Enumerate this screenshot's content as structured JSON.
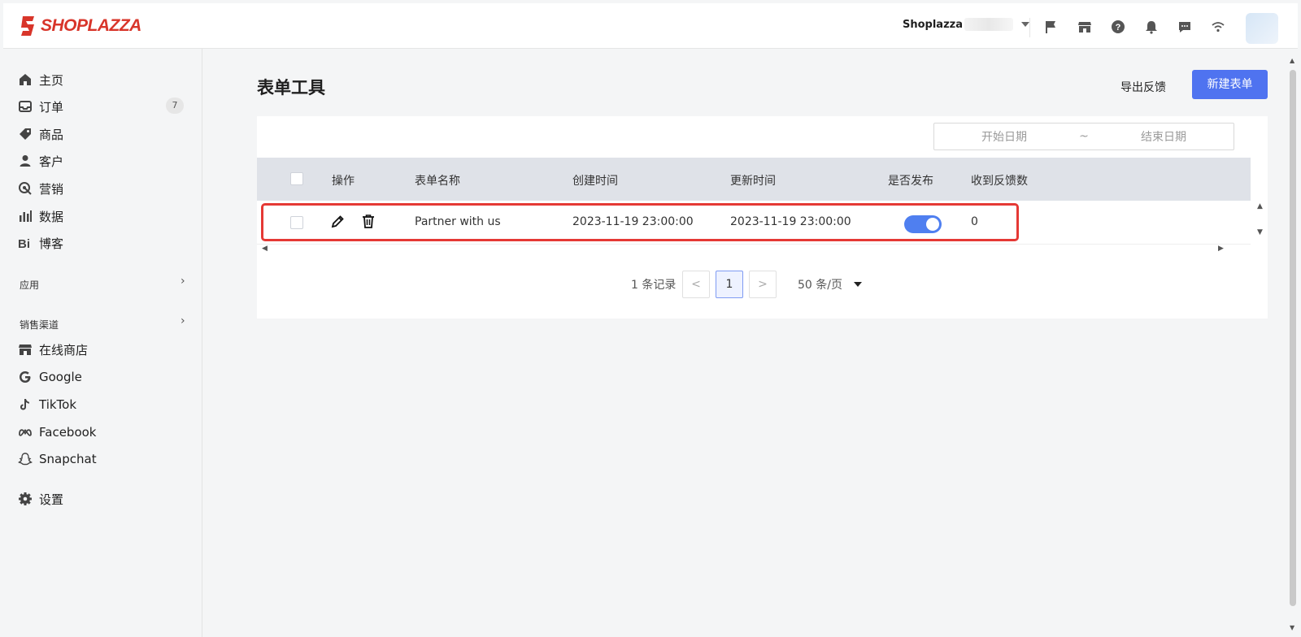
{
  "brand": {
    "name": "SHOPLAZZA",
    "color": "#d8352a"
  },
  "topbar": {
    "store_name": "Shoplazza",
    "icons": [
      "flag-icon",
      "store-icon",
      "help-icon",
      "bell-icon",
      "chat-icon",
      "wifi-icon"
    ]
  },
  "sidebar": {
    "items": [
      {
        "label": "主页",
        "icon": "home-icon"
      },
      {
        "label": "订单",
        "icon": "inbox-icon",
        "badge": "7"
      },
      {
        "label": "商品",
        "icon": "tag-icon"
      },
      {
        "label": "客户",
        "icon": "user-icon"
      },
      {
        "label": "营销",
        "icon": "target-icon"
      },
      {
        "label": "数据",
        "icon": "bar-chart-icon"
      },
      {
        "label": "博客",
        "icon": "blog-icon"
      }
    ],
    "apps_title": "应用",
    "channels_title": "销售渠道",
    "channels": [
      {
        "label": "在线商店",
        "icon": "store-icon"
      },
      {
        "label": "Google",
        "icon": "google-icon"
      },
      {
        "label": "TikTok",
        "icon": "tiktok-icon"
      },
      {
        "label": "Facebook",
        "icon": "meta-icon"
      },
      {
        "label": "Snapchat",
        "icon": "snapchat-icon"
      }
    ],
    "settings_label": "设置"
  },
  "main": {
    "title": "表单工具",
    "export_label": "导出反馈",
    "new_button_label": "新建表单",
    "date_start_placeholder": "开始日期",
    "date_separator": "~",
    "date_end_placeholder": "结束日期",
    "table": {
      "columns": [
        "操作",
        "表单名称",
        "创建时间",
        "更新时间",
        "是否发布",
        "收到反馈数"
      ],
      "rows": [
        {
          "name": "Partner with us",
          "created": "2023-11-19 23:00:00",
          "updated": "2023-11-19 23:00:00",
          "published": true,
          "feedback_count": "0"
        }
      ]
    },
    "pagination": {
      "total_label": "1 条记录",
      "prev": "<",
      "current_page": "1",
      "next": ">",
      "page_size_label": "50 条/页"
    }
  },
  "colors": {
    "primary": "#4f73f0",
    "highlight": "#e53935",
    "toggle_on": "#4f7ff0"
  }
}
